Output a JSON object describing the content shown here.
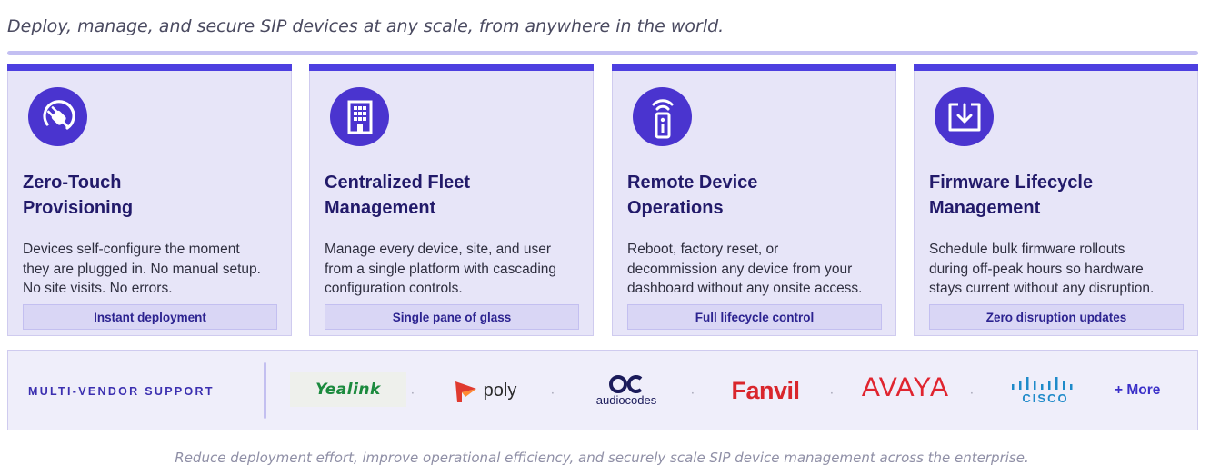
{
  "tagline": "Deploy, manage, and secure SIP devices at any scale, from anywhere in the world.",
  "cards": [
    {
      "icon": "power-plug-icon",
      "title_line1": "Zero-Touch",
      "title_line2": "Provisioning",
      "desc_line1": "Devices self-configure the moment",
      "desc_line2": "they are plugged in. No manual setup.",
      "desc_line3": "No site visits. No errors.",
      "pill": "Instant deployment"
    },
    {
      "icon": "building-icon",
      "title_line1": "Centralized Fleet",
      "title_line2": "Management",
      "desc_line1": "Manage every device, site, and user",
      "desc_line2": "from a single platform with cascading",
      "desc_line3": "configuration controls.",
      "pill": "Single pane of glass"
    },
    {
      "icon": "remote-control-icon",
      "title_line1": "Remote Device",
      "title_line2": "Operations",
      "desc_line1": "Reboot, factory reset, or",
      "desc_line2": "decommission any device from your",
      "desc_line3": "dashboard without any onsite access.",
      "pill": "Full lifecycle control"
    },
    {
      "icon": "download-box-icon",
      "title_line1": "Firmware Lifecycle",
      "title_line2": "Management",
      "desc_line1": "Schedule bulk firmware rollouts",
      "desc_line2": "during off-peak hours so hardware",
      "desc_line3": "stays current without any disruption.",
      "pill": "Zero disruption updates"
    }
  ],
  "vendors": {
    "label": "MULTI-VENDOR SUPPORT",
    "logos": [
      "Yealink",
      "poly",
      "audiocodes",
      "Fanvil",
      "AVAYA",
      "CISCO"
    ],
    "separator": "·",
    "more": "+ More"
  },
  "colors": {
    "accent": "#4d3fe0",
    "icon_bg": "#4a34cf",
    "card_bg": "#e7e5f8",
    "yealink": "#1b8a3e",
    "poly_red": "#e03a2f",
    "fanvil_red": "#d9262c",
    "avaya_red": "#e0242f",
    "cisco_blue": "#1e8ac9"
  },
  "footer": "Reduce deployment effort, improve operational efficiency, and securely scale SIP device management across the enterprise."
}
